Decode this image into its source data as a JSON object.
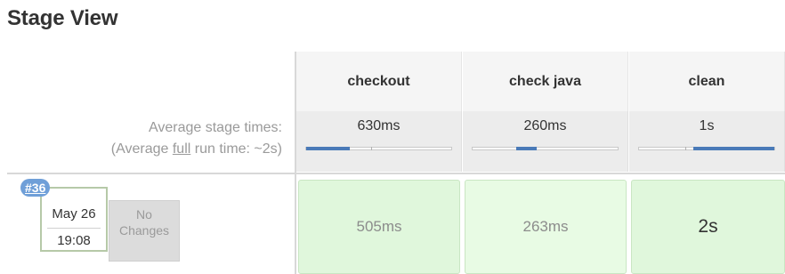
{
  "title": "Stage View",
  "legend": {
    "avg_line1": "Average stage times:",
    "avg_line2_prefix": "(Average ",
    "avg_line2_link": "full",
    "avg_line2_suffix": " run time: ~2s)"
  },
  "stages": [
    {
      "name": "checkout",
      "avg": "630ms",
      "avg_fraction": 0.3
    },
    {
      "name": "check java",
      "avg": "260ms",
      "avg_fraction": 0.13
    },
    {
      "name": "clean",
      "avg": "1s",
      "avg_fraction": 0.6
    }
  ],
  "run": {
    "build": "#36",
    "date": "May 26",
    "time": "19:08",
    "changes_line1": "No",
    "changes_line2": "Changes",
    "durations": [
      "505ms",
      "263ms",
      "2s"
    ]
  },
  "colors": {
    "success_cell": "#e0f7dc",
    "progress_fill": "#4a7ab8",
    "badge": "#6f9fd8"
  }
}
